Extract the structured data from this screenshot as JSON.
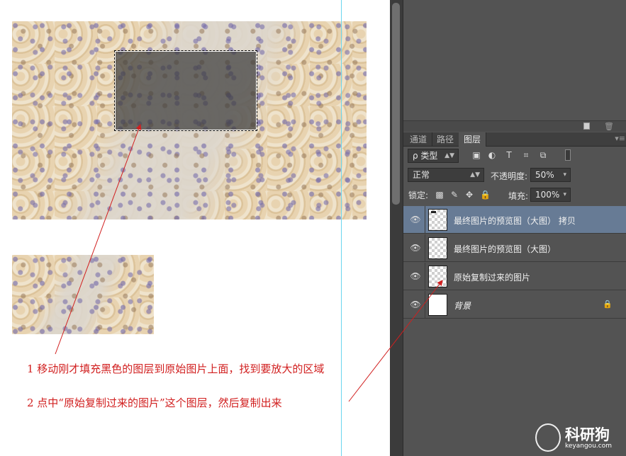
{
  "canvas": {
    "annotations": [
      "1 移动刚才填充黑色的图层到原始图片上面，找到要放大的区域",
      "2 点中“原始复制过来的图片”这个图层，然后复制出来"
    ]
  },
  "panel": {
    "tabs": [
      {
        "label": "通道",
        "active": false
      },
      {
        "label": "路径",
        "active": false
      },
      {
        "label": "图层",
        "active": true
      }
    ],
    "filter": {
      "label": "ρ 类型"
    },
    "filter_icons": [
      "image-filter-icon",
      "adjustment-filter-icon",
      "type-filter-icon",
      "shape-filter-icon",
      "smart-object-filter-icon"
    ],
    "blend_mode": "正常",
    "opacity_label": "不透明度:",
    "opacity_value": "50%",
    "lock_label": "锁定:",
    "fill_label": "填充:",
    "fill_value": "100%",
    "layers": [
      {
        "name": "最终图片的预览图（大图） 拷贝",
        "selected": true,
        "visible": true
      },
      {
        "name": "最终图片的预览图（大图）",
        "selected": false,
        "visible": true
      },
      {
        "name": "原始复制过来的图片",
        "selected": false,
        "visible": true
      },
      {
        "name": "背景",
        "selected": false,
        "visible": true,
        "locked": true
      }
    ]
  },
  "watermark": {
    "brand": "科研狗",
    "url": "keyangou.com"
  },
  "colors": {
    "annotation": "#d11f1f",
    "panel_bg": "#535353",
    "selected_layer": "#677b95",
    "guide": "#69d6ee"
  }
}
